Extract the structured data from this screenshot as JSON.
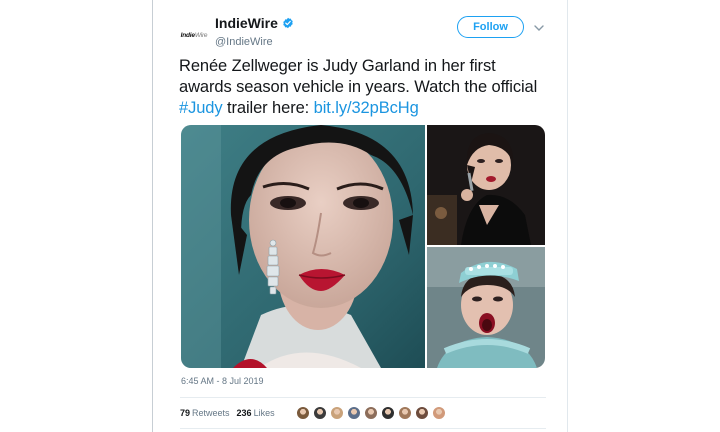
{
  "account": {
    "logo_main": "Indie",
    "logo_sub": "Wire",
    "display_name": "IndieWire",
    "handle": "@IndieWire",
    "verified": true
  },
  "actions": {
    "follow_label": "Follow"
  },
  "tweet": {
    "text_before_hashtag": "Renée Zellweger is Judy Garland in her first awards season vehicle in years. Watch the official ",
    "hashtag": "#Judy",
    "text_between": " trailer here: ",
    "link": "bit.ly/32pBcHg"
  },
  "timestamp": "6:45 AM - 8 Jul 2019",
  "stats": {
    "retweets_count": "79",
    "retweets_label": "Retweets",
    "likes_count": "236",
    "likes_label": "Likes"
  },
  "likers": [
    "#7a5a3c",
    "#3b3b3b",
    "#c9a27a",
    "#5b6e8a",
    "#8c6d5a",
    "#2f2f2f",
    "#a0785a",
    "#6d4c3d",
    "#d19a7a"
  ],
  "colors": {
    "accent": "#1da1f2",
    "link": "#1b95e0",
    "muted": "#657786",
    "text": "#14171a"
  }
}
